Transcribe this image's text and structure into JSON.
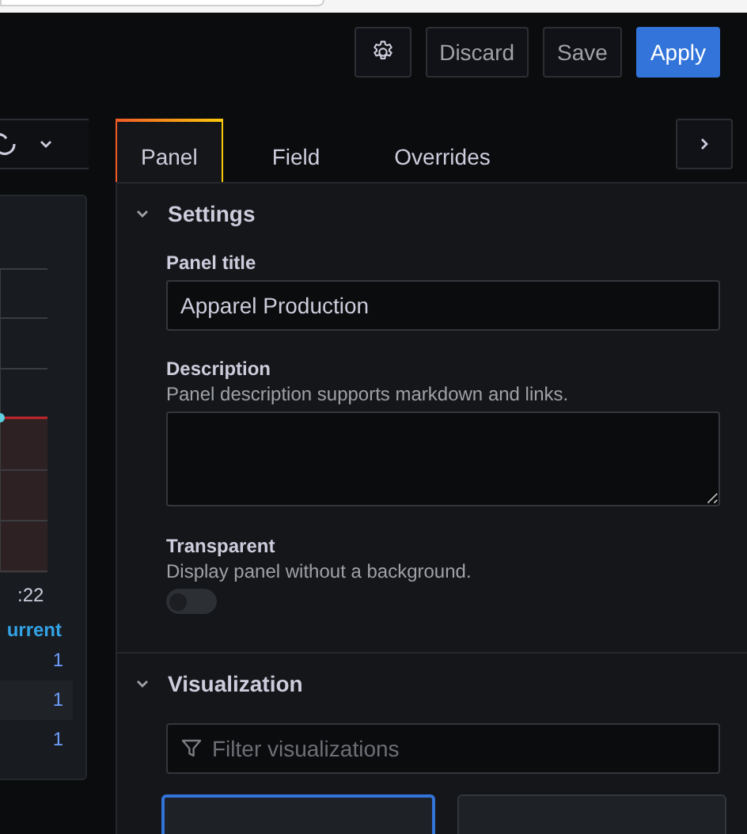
{
  "toolbar": {
    "buttons": [
      {
        "kind": "icon"
      },
      {
        "kind": "secondary",
        "label": "Discard"
      },
      {
        "kind": "secondary",
        "label": "Save"
      },
      {
        "kind": "primary",
        "label": "Apply"
      }
    ]
  },
  "graph_panel": {
    "time_label": ":22",
    "legend_header": "urrent",
    "legend_rows": [
      {
        "value": "1"
      },
      {
        "value": "1"
      },
      {
        "value": "1"
      }
    ]
  },
  "tabs": [
    {
      "label": "Panel",
      "selected": true
    },
    {
      "label": "Field",
      "selected": false
    },
    {
      "label": "Overrides",
      "selected": false
    }
  ],
  "settings": {
    "title": "Settings",
    "expanded": true,
    "panel_title": {
      "label": "Panel title",
      "value": "Apparel Production"
    },
    "description": {
      "label": "Description",
      "help": "Panel description supports markdown and links."
    },
    "transparent": {
      "label": "Transparent",
      "help": "Display panel without a background.",
      "on": false
    }
  },
  "visualization": {
    "title": "Visualization",
    "expanded": true,
    "filter": {
      "placeholder": "Filter visualizations"
    },
    "cards": [
      {
        "selected": true
      },
      {
        "selected": false
      }
    ]
  }
}
